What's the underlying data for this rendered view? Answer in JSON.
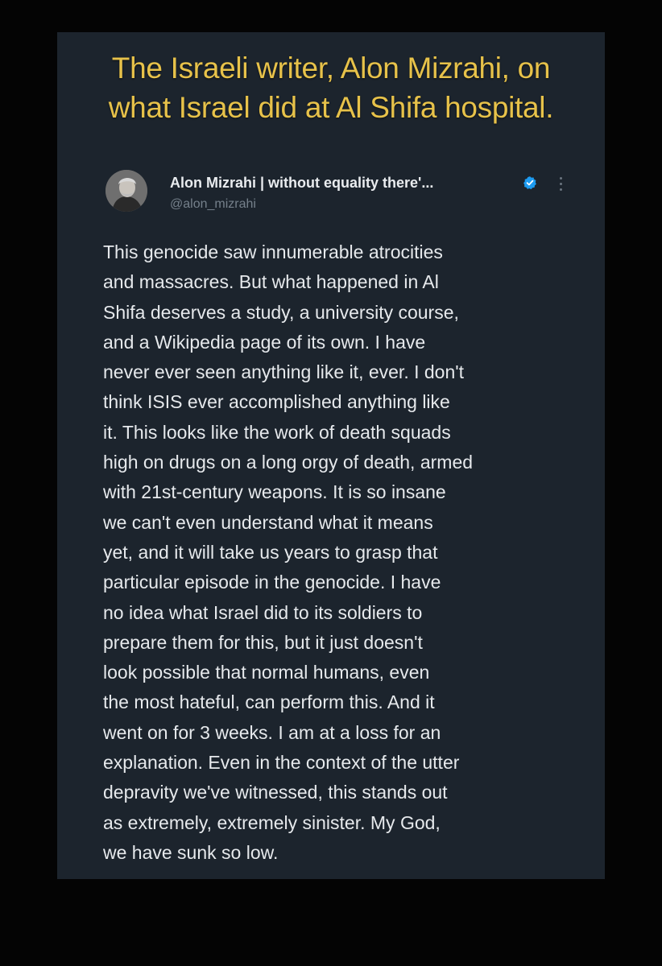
{
  "headline": {
    "line1": "The Israeli writer, Alon Mizrahi, on",
    "line2": "what Israel did at Al Shifa hospital."
  },
  "tweet": {
    "author_name": "Alon Mizrahi | without equality there'...",
    "handle": "@alon_mizrahi",
    "verified_icon": "verified-badge-icon",
    "more_icon": "more-options-icon",
    "accent_color": "#1d9bf0",
    "body_lines": [
      "This genocide saw innumerable atrocities",
      "and massacres. But what happened in Al",
      "Shifa deserves a study, a university course,",
      "and a Wikipedia page of its own. I have",
      "never ever seen anything like it, ever. I don't",
      "think ISIS ever accomplished anything like",
      "it. This looks like the work of death squads",
      "high on drugs on a long orgy of death, armed",
      "with 21st-century weapons. It is so insane",
      "we can't even understand what it means",
      "yet, and it will take us years to grasp that",
      "particular episode in the genocide. I have",
      "no idea what Israel did to its soldiers to",
      "prepare them for this, but it just doesn't",
      "look possible that normal humans, even",
      "the most hateful, can perform this. And it",
      "went on for 3 weeks. I am at a loss for an",
      "explanation. Even in the context of the utter",
      "depravity we've witnessed, this stands out",
      "as extremely, extremely sinister. My God,",
      "we have sunk so low."
    ]
  },
  "colors": {
    "page_background": "#040404",
    "card_background": "#1c242d",
    "headline": "#e7c24a",
    "body_text": "#e6e9ec",
    "handle_text": "#75808b"
  }
}
